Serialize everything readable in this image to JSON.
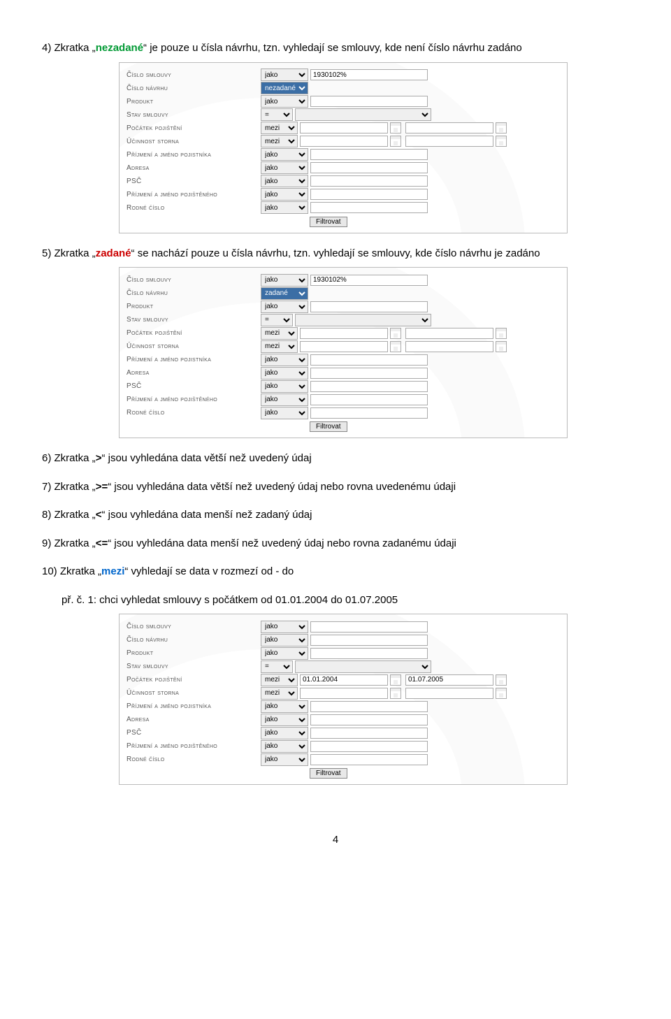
{
  "text": {
    "p4a": "4)  Zkratka „",
    "p4w": "nezadané",
    "p4b": "“ je pouze u čísla návrhu, tzn. vyhledají se smlouvy, kde není číslo návrhu zadáno",
    "p5a": "5)  Zkratka „",
    "p5w": "zadané",
    "p5b": "“ se nachází pouze u čísla návrhu, tzn. vyhledají se smlouvy, kde číslo návrhu je zadáno",
    "p6a": "6)  Zkratka „",
    "p6w": ">",
    "p6b": "“ jsou vyhledána data větší než uvedený údaj",
    "p7a": "7)  Zkratka „",
    "p7w": ">=",
    "p7b": "“ jsou vyhledána data větší než uvedený údaj nebo rovna uvedenému údaji",
    "p8a": "8)  Zkratka „",
    "p8w": "<",
    "p8b": "“ jsou vyhledána data menší než zadaný údaj",
    "p9a": "9)  Zkratka „",
    "p9w": "<=",
    "p9b": "“ jsou vyhledána data menší než uvedený údaj nebo rovna zadanému údaji",
    "p10a": "10) Zkratka „",
    "p10w": "mezi",
    "p10b": "“ vyhledají se data v rozmezí od  - do",
    "p10c": "př. č. 1: chci vyhledat smlouvy s počátkem od 01.01.2004 do 01.07.2005",
    "pageNum": "4"
  },
  "labels": {
    "rows": [
      "Číslo smlouvy",
      "Číslo návrhu",
      "Produkt",
      "Stav smlouvy",
      "Počátek pojištění",
      "Účinnost storna",
      "Příjmení a jméno pojistníka",
      "Adresa",
      "PSČ",
      "Příjmení a jméno pojištěného",
      "Rodné číslo"
    ],
    "op_jako": "jako",
    "op_nezadane": "nezadané",
    "op_zadane": "zadané",
    "op_eq": "=",
    "op_mezi": "mezi",
    "btn": "Filtrovat"
  },
  "panel1": {
    "cislo_smlouvy_value": "1930102%",
    "cislo_navrhu_op": "nezadané"
  },
  "panel2": {
    "cislo_smlouvy_value": "1930102%",
    "cislo_navrhu_op": "zadané"
  },
  "panel3": {
    "pocatek_from": "01.01.2004",
    "pocatek_to": "01.07.2005"
  }
}
